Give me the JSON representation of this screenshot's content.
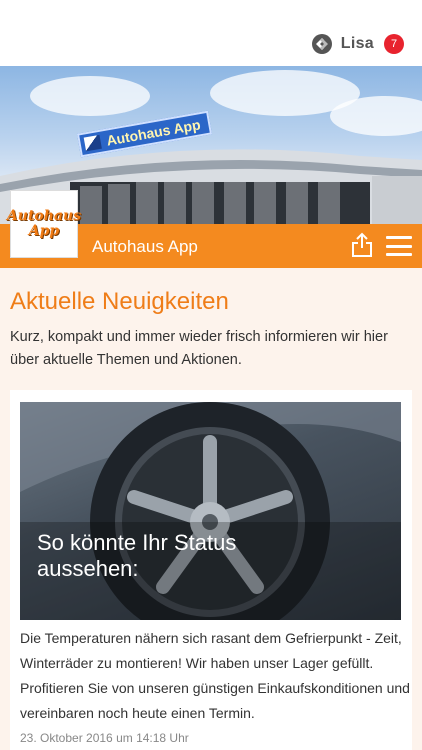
{
  "user": {
    "name": "Lisa",
    "notification_count": "7",
    "icon": "app-logo-icon"
  },
  "header": {
    "app_title": "Autohaus App",
    "sign_text": "Autohaus App",
    "logo_line1": "Autohaus",
    "logo_line2": "App",
    "share_icon": "share-icon",
    "menu_icon": "hamburger-menu-icon"
  },
  "main": {
    "title": "Aktuelle Neuigkeiten",
    "intro": "Kurz, kompakt und immer wieder frisch informieren wir hier über aktuelle Themen und Aktionen."
  },
  "news": [
    {
      "headline_line1": "So könnte Ihr Status",
      "headline_line2": "aussehen:",
      "text": "Die Temperaturen nähern sich rasant dem Gefrierpunkt - Zeit, Winterräder zu montieren! Wir haben unser Lager gefüllt. Profitieren Sie von unseren günstigen Einkaufskonditionen und vereinbaren noch heute einen Termin.",
      "date": "23. Oktober 2016 um 14:18 Uhr"
    }
  ],
  "colors": {
    "accent": "#f48a1f",
    "title": "#ef7d18",
    "badge": "#e8232e",
    "background": "#fdf3ec"
  }
}
